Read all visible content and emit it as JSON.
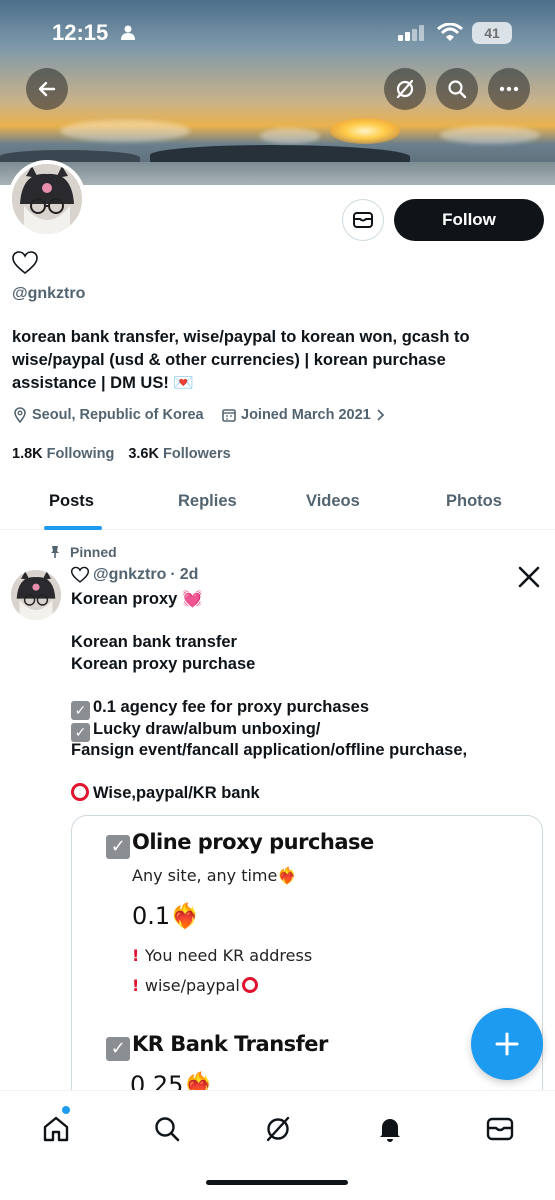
{
  "status_bar": {
    "time": "12:15",
    "battery": "41"
  },
  "profile": {
    "handle": "@gnkztro",
    "bio": "korean bank transfer, wise/paypal to korean won, gcash to wise/paypal (usd & other currencies) | korean purchase assistance | DM US! 💌",
    "location": "Seoul, Republic of Korea",
    "joined": "Joined March 2021",
    "following_count": "1.8K",
    "following_label": "Following",
    "followers_count": "3.6K",
    "followers_label": "Followers",
    "follow_label": "Follow"
  },
  "tabs": [
    {
      "label": "Posts",
      "active": true
    },
    {
      "label": "Replies",
      "active": false
    },
    {
      "label": "Videos",
      "active": false
    },
    {
      "label": "Photos",
      "active": false
    }
  ],
  "post": {
    "pinned_label": "Pinned",
    "handle": "@gnkztro",
    "time": "2d",
    "lines": {
      "l1": "Korean proxy 💓",
      "l3": "Korean bank transfer",
      "l4": "Korean proxy purchase",
      "l6": "0.1 agency fee for proxy purchases",
      "l7": "Lucky draw/album unboxing/",
      "l8": "Fansign event/fancall application/offline purchase,",
      "l10": "Wise,paypal/KR bank"
    },
    "card": {
      "h1": "Oline proxy purchase",
      "p1": "Any site, any time❤️‍🔥",
      "v1": "0.1❤️‍🔥",
      "p2": "You need KR address",
      "p3": "wise/paypal",
      "h2": "KR Bank Transfer",
      "v2": "0.25❤️‍🔥"
    }
  },
  "colors": {
    "accent": "#1d9bf0",
    "text": "#0f1419",
    "muted": "#536471"
  }
}
